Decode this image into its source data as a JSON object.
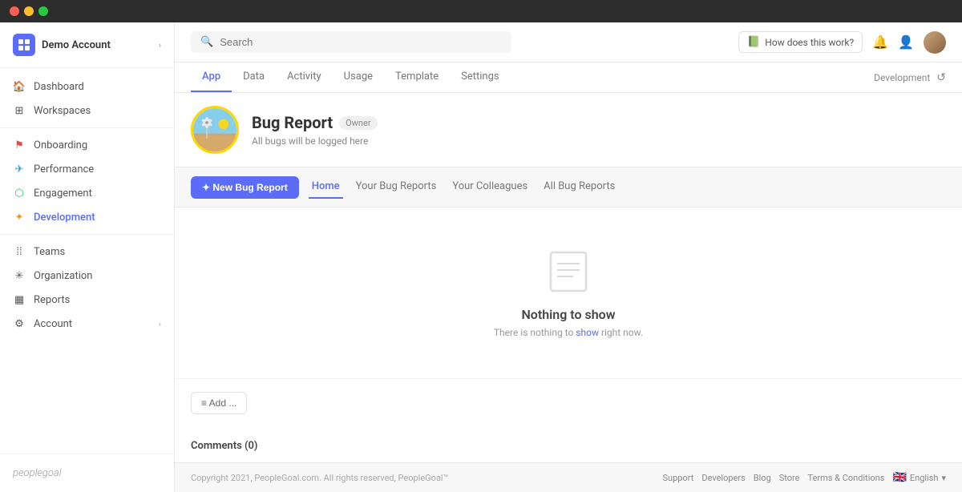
{
  "titlebar": {
    "lights": [
      "red",
      "yellow",
      "green"
    ]
  },
  "sidebar": {
    "account_name": "Demo Account",
    "nav_items": [
      {
        "id": "dashboard",
        "label": "Dashboard",
        "icon": "house"
      },
      {
        "id": "workspaces",
        "label": "Workspaces",
        "icon": "grid"
      }
    ],
    "section_items": [
      {
        "id": "onboarding",
        "label": "Onboarding",
        "icon": "flag",
        "color": "#e74c3c"
      },
      {
        "id": "performance",
        "label": "Performance",
        "icon": "bolt",
        "color": "#3498db"
      },
      {
        "id": "engagement",
        "label": "Engagement",
        "icon": "chart",
        "color": "#2ecc71"
      },
      {
        "id": "development",
        "label": "Development",
        "icon": "star",
        "color": "#f39c12",
        "active": true
      }
    ],
    "bottom_items": [
      {
        "id": "teams",
        "label": "Teams",
        "icon": "users"
      },
      {
        "id": "organization",
        "label": "Organization",
        "icon": "gear"
      },
      {
        "id": "reports",
        "label": "Reports",
        "icon": "report"
      },
      {
        "id": "account",
        "label": "Account",
        "icon": "person",
        "has_chevron": true
      }
    ],
    "logo_text": "peoplegoal"
  },
  "header": {
    "search_placeholder": "Search",
    "how_does_it_work": "How does this work?",
    "environment": "Development"
  },
  "top_tabs": [
    {
      "id": "app",
      "label": "App",
      "active": true
    },
    {
      "id": "data",
      "label": "Data"
    },
    {
      "id": "activity",
      "label": "Activity"
    },
    {
      "id": "usage",
      "label": "Usage"
    },
    {
      "id": "template",
      "label": "Template"
    },
    {
      "id": "settings",
      "label": "Settings"
    }
  ],
  "app_info": {
    "title": "Bug Report",
    "badge": "Owner",
    "description": "All bugs will be logged here"
  },
  "sub_tabs": [
    {
      "id": "home",
      "label": "Home",
      "active": true
    },
    {
      "id": "your_bug_reports",
      "label": "Your Bug Reports"
    },
    {
      "id": "your_colleagues",
      "label": "Your Colleagues"
    },
    {
      "id": "all_bug_reports",
      "label": "All Bug Reports"
    }
  ],
  "new_bug_btn": "✦ New Bug Report",
  "empty_state": {
    "title": "Nothing to show",
    "description": "There is nothing to show right now."
  },
  "add_btn": "≡  Add ...",
  "comments": {
    "title": "Comments (0)"
  },
  "footer": {
    "copyright": "Copyright 2021, PeopleGoal.com. All rights reserved, PeopleGoal™",
    "links": [
      "Support",
      "Developers",
      "Blog",
      "Store",
      "Terms & Conditions"
    ],
    "language": "English"
  }
}
